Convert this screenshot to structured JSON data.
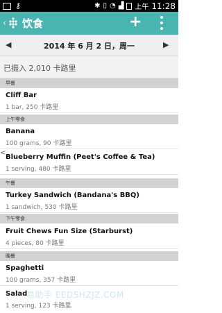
{
  "status_bar": {
    "time": "11:28",
    "am_pm": "上午"
  },
  "app": {
    "back_symbol": "‹",
    "title": "饮食",
    "add_symbol": "+"
  },
  "date_nav": {
    "prev_symbol": "◀",
    "next_symbol": "▶",
    "date": "2014 年 6 月 2 日，周一"
  },
  "summary": {
    "text": "已摄入 2,010 卡路里"
  },
  "meals": [
    {
      "name": "早餐",
      "items": [
        {
          "name": "Cliff Bar",
          "detail": "1 bar, 250 卡路里"
        }
      ]
    },
    {
      "name": "上午零食",
      "items": [
        {
          "name": "Banana",
          "detail": "100 grams, 90 卡路里"
        },
        {
          "name": "Blueberry Muffin (Peet's Coffee & Tea)",
          "detail": "1 serving, 480 卡路里"
        }
      ]
    },
    {
      "name": "午餐",
      "items": [
        {
          "name": "Turkey Sandwich (Bandana's BBQ)",
          "detail": "1 sandwich, 530 卡路里"
        }
      ]
    },
    {
      "name": "下午零食",
      "items": [
        {
          "name": "Fruit Chews Fun Size (Starburst)",
          "detail": "4 pieces, 80 卡路里"
        }
      ]
    },
    {
      "name": "晚餐",
      "items": [
        {
          "name": "Spaghetti",
          "detail": "100 grams, 357 卡路里"
        },
        {
          "name": "Salad",
          "detail": "1 serving, 123 卡路里"
        }
      ]
    }
  ],
  "edge_arrow": "<",
  "watermark": "易助手 EEDSHZJZ.COM",
  "colors": {
    "accent": "#49b5b0"
  },
  "icons": [
    "back-icon",
    "logo-icon",
    "add-icon",
    "overflow-menu-icon",
    "prev-day-icon",
    "next-day-icon"
  ]
}
